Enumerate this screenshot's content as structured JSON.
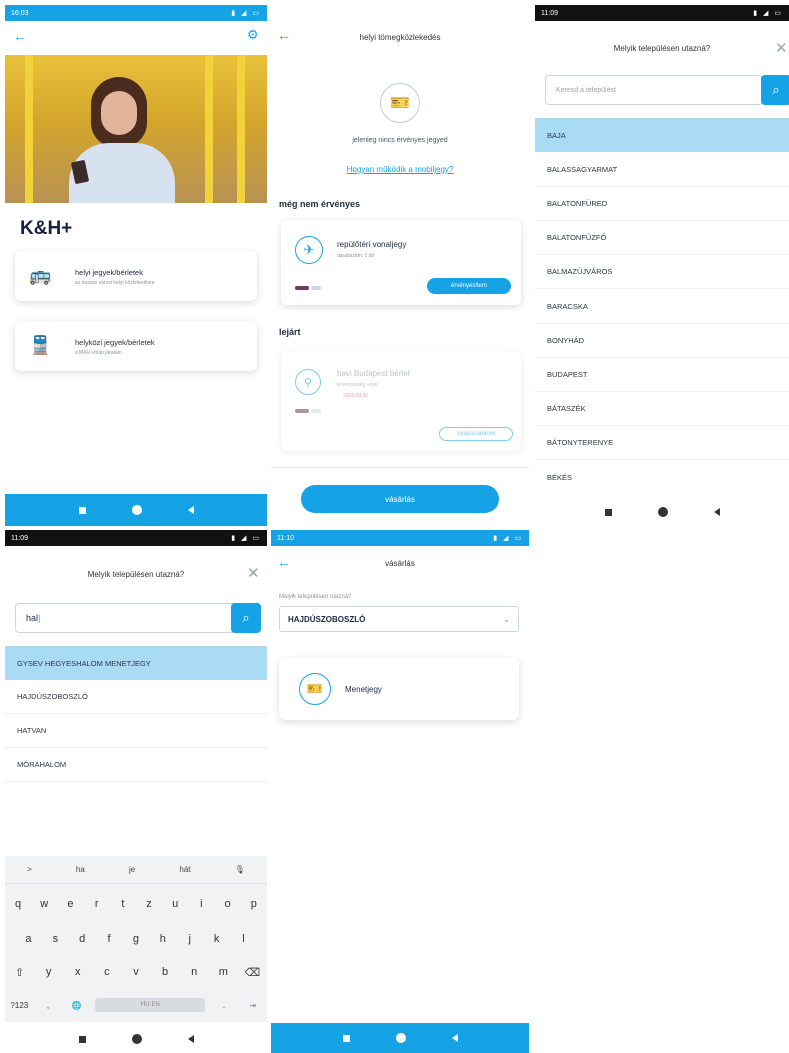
{
  "screen1": {
    "status_time": "16:03",
    "brand": "K&H+",
    "cards": [
      {
        "title": "helyi jegyek/bérletek",
        "subtitle": "az összes városi helyi közlekedésre",
        "icon": "bus-icon"
      },
      {
        "title": "helyközi jegyek/bérletek",
        "subtitle": "a MÁV-Volán járatain",
        "icon": "train-icon"
      }
    ]
  },
  "screen2": {
    "title": "helyi tömegközlekedés",
    "no_ticket": "jelenleg nincs érvényes jegyed",
    "how_link": "Hogyan működik a mobiljegy?",
    "section_not_valid": "még nem érvényes",
    "ticket1_title": "repülőtéri vonaljegy",
    "ticket1_sub": "darabszám: 1 db",
    "ticket1_btn": "érvényesítem",
    "section_expired": "lejárt",
    "ticket2_title": "havi Budapest bérlet",
    "ticket2_sub": "érvényesség vége",
    "ticket2_date": "2019.09.30.",
    "ticket2_btn": "újravásárolom",
    "buy_btn": "vásárlás"
  },
  "screen3": {
    "status_time": "11:09",
    "title": "Melyik településen utazná?",
    "search_placeholder": "Keresd a települést",
    "items": [
      "BAJA",
      "BALASSAGYARMAT",
      "BALATONFÜRED",
      "BALATONFŰZFŐ",
      "BALMAZÚJVÁROS",
      "BARACSKA",
      "BONYHÁD",
      "BUDAPEST",
      "BÁTASZÉK",
      "BÁTONYTERENYE",
      "BÉKÉS"
    ]
  },
  "screen4": {
    "status_time": "11:09",
    "title": "Melyik településen utazná?",
    "search_value": "hal",
    "items": [
      "GYSEV HEGYESHALOM MENETJEGY",
      "HAJDÚSZOBOSZLÓ",
      "HATVAN",
      "MÓRAHALOM"
    ],
    "keyboard": {
      "suggestions": [
        ">",
        "ha",
        "je",
        "hát",
        "🎙"
      ],
      "row1": [
        "q",
        "w",
        "e",
        "r",
        "t",
        "z",
        "u",
        "i",
        "o",
        "p"
      ],
      "row2": [
        "a",
        "s",
        "d",
        "f",
        "g",
        "h",
        "j",
        "k",
        "l"
      ],
      "row3": [
        "⇧",
        "y",
        "x",
        "c",
        "v",
        "b",
        "n",
        "m",
        "⌫"
      ],
      "row4": [
        "?123",
        ",",
        "🌐",
        "HU·EN",
        ".",
        "⇥"
      ]
    }
  },
  "screen5": {
    "status_time": "11:10",
    "title": "vásárlás",
    "field_label": "Melyik településen utazná?",
    "selected_city": "HAJDÚSZOBOSZLÓ",
    "product": "Menetjegy"
  }
}
